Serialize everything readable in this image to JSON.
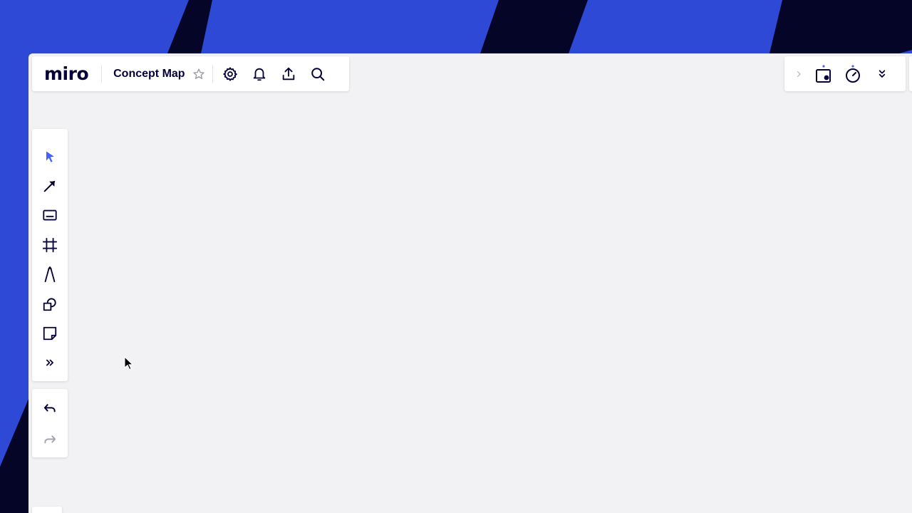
{
  "app": {
    "logo_text": "miro",
    "board_title": "Concept Map"
  },
  "colors": {
    "accent": "#4262ff",
    "brand_blue": "#2d49d6",
    "navy": "#050038",
    "canvas": "#f2f2f4",
    "disabled": "#a5a5b0"
  },
  "topbar": {
    "icons": [
      "star-icon",
      "gear-icon",
      "bell-icon",
      "upload-icon",
      "search-icon"
    ]
  },
  "right_toolbar": {
    "icons": [
      "chevron-right-icon",
      "video-frame-icon",
      "timer-icon",
      "double-chevron-down-icon"
    ]
  },
  "toolbar": {
    "tools": [
      {
        "id": "select",
        "icon": "cursor-arrow-icon",
        "active": true
      },
      {
        "id": "connection-line",
        "icon": "arrow-line-icon",
        "active": false
      },
      {
        "id": "text",
        "icon": "text-box-icon",
        "active": false
      },
      {
        "id": "frame",
        "icon": "frame-icon",
        "active": false
      },
      {
        "id": "pen",
        "icon": "pen-icon",
        "active": false
      },
      {
        "id": "shapes",
        "icon": "shapes-icon",
        "active": false
      },
      {
        "id": "sticky-note",
        "icon": "sticky-note-icon",
        "active": false
      },
      {
        "id": "more-tools",
        "icon": "double-chevron-right-icon",
        "active": false
      }
    ],
    "undo": {
      "icon": "undo-icon",
      "enabled": true
    },
    "redo": {
      "icon": "redo-icon",
      "enabled": false
    }
  }
}
